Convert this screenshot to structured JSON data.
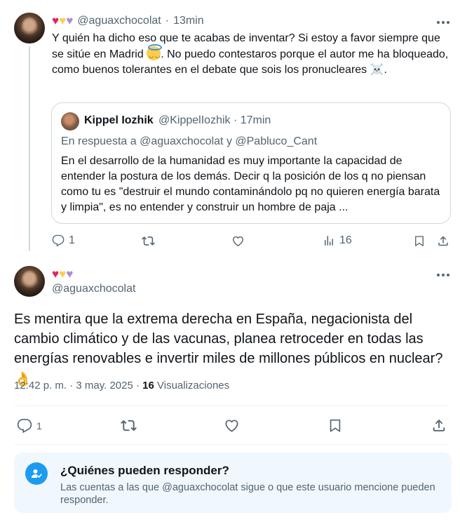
{
  "reply_tweet": {
    "hearts": [
      "❤",
      "💛",
      "💜"
    ],
    "handle": "@aguaxchocolat",
    "time": "13min",
    "text_part1": "Y quién ha dicho eso que te acabas de inventar? Si estoy a favor siempre que se sitúe en Madrid ",
    "text_part2": ". No puedo contestaros porque el autor me ha bloqueado, como buenos tolerantes en el debate que sois los pronucleares ",
    "text_part3": ".",
    "skull_emoji": "☠️",
    "quote": {
      "name": "Kippel Iozhik",
      "handle": "@KippelIozhik",
      "time": "17min",
      "replying": "En respuesta a @aguaxchocolat y @Pabluco_Cant",
      "text": "En el desarrollo de la humanidad es muy importante la capacidad de entender la postura de los demás. Decir q la posición de los q no piensan como tu es \"destruir el mundo contaminándolo pq no quieren energía barata y limpia\", es no entender y construir un hombre de paja ..."
    },
    "actions": {
      "replies": "1",
      "views": "16"
    }
  },
  "main_tweet": {
    "hearts": [
      "❤",
      "💛",
      "💜"
    ],
    "handle": "@aguaxchocolat",
    "text": "Es mentira que la extrema derecha en España, negacionista del cambio climático y de las vacunas, planea retroceder en todas las energías renovables e invertir miles de millones públicos en nuclear? ",
    "emoji": "👌",
    "timestamp": "12:42 p. m. · 3 may. 2025 · ",
    "views_count": "16",
    "views_label": "Visualizaciones",
    "actions": {
      "replies": "1"
    }
  },
  "who_can_reply": {
    "title": "¿Quiénes pueden responder?",
    "description": "Las cuentas a las que @aguaxchocolat sigue o que este usuario mencione pueden responder."
  },
  "colors": {
    "accent": "#1d9bf0",
    "muted": "#536471",
    "text": "#0f1419"
  }
}
